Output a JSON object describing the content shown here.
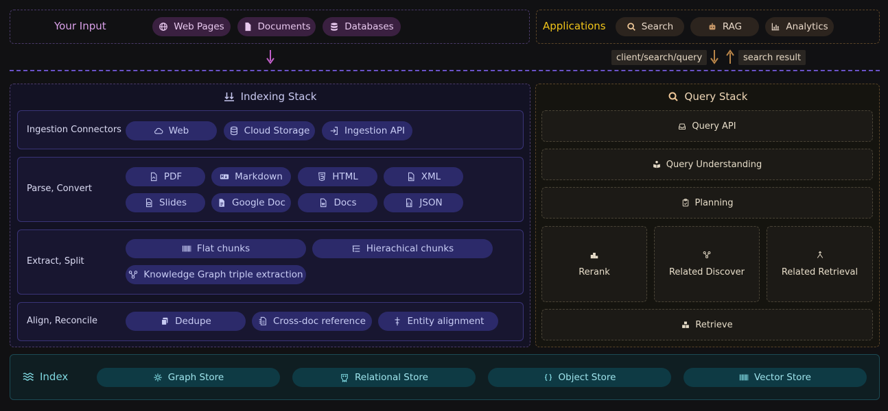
{
  "input": {
    "title": "Your Input",
    "items": [
      "Web Pages",
      "Documents",
      "Databases"
    ]
  },
  "applications": {
    "title": "Applications",
    "items": [
      "Search",
      "RAG",
      "Analytics"
    ]
  },
  "flow": {
    "request": "client/search/query",
    "response": "search result"
  },
  "indexing": {
    "title": "Indexing Stack",
    "rows": [
      {
        "label": "Ingestion Connectors",
        "items": [
          "Web",
          "Cloud Storage",
          "Ingestion API"
        ]
      },
      {
        "label": "Parse, Convert",
        "items": [
          "PDF",
          "Markdown",
          "HTML",
          "XML",
          "Slides",
          "Google Doc",
          "Docs",
          "JSON"
        ]
      },
      {
        "label": "Extract, Split",
        "items": [
          "Flat chunks",
          "Hierachical chunks",
          "Knowledge Graph triple extraction"
        ]
      },
      {
        "label": "Align, Reconcile",
        "items": [
          "Dedupe",
          "Cross-doc reference",
          "Entity alignment"
        ]
      }
    ]
  },
  "query": {
    "title": "Query Stack",
    "layers": [
      "Query API",
      "Query Understanding",
      "Planning"
    ],
    "parallel": [
      "Rerank",
      "Related Discover",
      "Related Retrieval"
    ],
    "bottom": "Retrieve"
  },
  "index": {
    "title": "Index",
    "stores": [
      "Graph Store",
      "Relational Store",
      "Object Store",
      "Vector Store"
    ]
  },
  "colors": {
    "input": "#d9a0e8",
    "applications": "#f0c419",
    "indexing": "#c8c8f0",
    "query": "#f0d8b8",
    "index": "#7fd8e0"
  }
}
